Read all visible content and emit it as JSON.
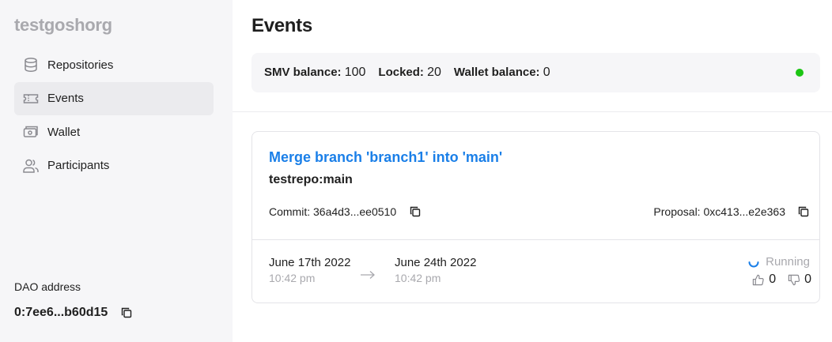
{
  "sidebar": {
    "org_name": "testgoshorg",
    "items": [
      {
        "label": "Repositories",
        "icon": "database-icon"
      },
      {
        "label": "Events",
        "icon": "ticket-icon",
        "active": true
      },
      {
        "label": "Wallet",
        "icon": "wallet-icon"
      },
      {
        "label": "Participants",
        "icon": "users-icon"
      }
    ],
    "dao_label": "DAO address",
    "dao_address": "0:7ee6...b60d15"
  },
  "main": {
    "title": "Events",
    "balances": {
      "smv_label": "SMV balance:",
      "smv_value": "100",
      "locked_label": "Locked:",
      "locked_value": "20",
      "wallet_label": "Wallet balance:",
      "wallet_value": "0",
      "status_color": "#1cc513"
    },
    "event": {
      "title": "Merge branch 'branch1' into 'main'",
      "branch": "testrepo:main",
      "commit": "Commit: 36a4d3...ee0510",
      "proposal": "Proposal: 0xc413...e2e363",
      "start_date": "June 17th 2022",
      "start_time": "10:42 pm",
      "end_date": "June 24th 2022",
      "end_time": "10:42 pm",
      "status": "Running",
      "votes_for": "0",
      "votes_against": "0"
    }
  },
  "colors": {
    "accent": "#1a7fe8",
    "sidebar_bg": "#f6f6f8",
    "muted": "#a9a9ae"
  }
}
